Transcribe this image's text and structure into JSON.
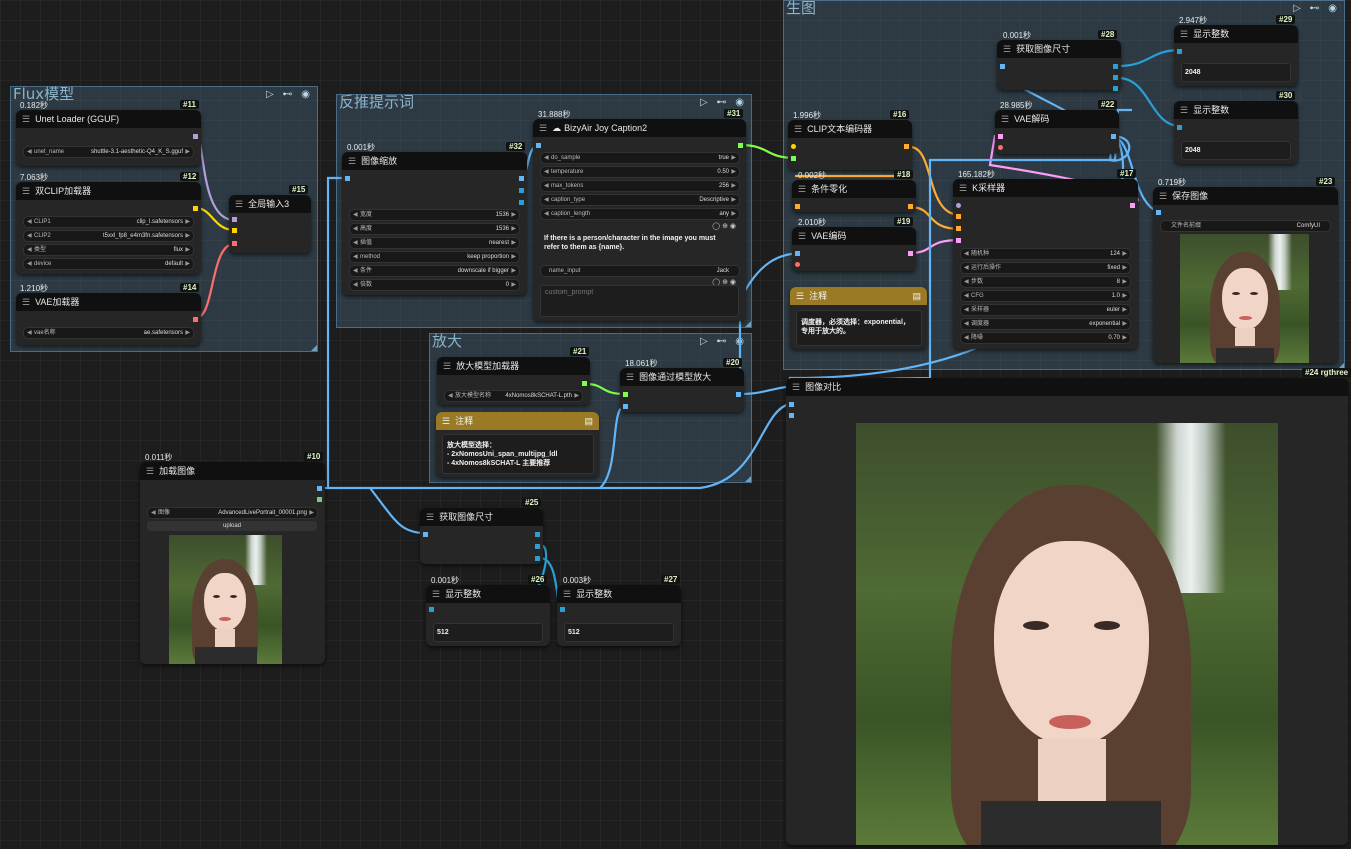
{
  "groups": {
    "flux": {
      "title": "Flux模型"
    },
    "prompt": {
      "title": "反推提示词"
    },
    "upscale": {
      "title": "放大"
    },
    "gen": {
      "title": "生图"
    }
  },
  "group_icons": "▷ ⊷ ◉",
  "nodes": {
    "n11": {
      "time": "0.182秒",
      "id": "#11",
      "title": "Unet Loader (GGUF)",
      "widgets": [
        {
          "label": "unet_name",
          "value": "shuttle-3.1-aesthetic-Q4_K_S.gguf"
        }
      ]
    },
    "n12": {
      "time": "7.063秒",
      "id": "#12",
      "title": "双CLIP加载器",
      "widgets": [
        {
          "label": "CLIP1",
          "value": "clip_l.safetensors"
        },
        {
          "label": "CLIP2",
          "value": "t5xxl_fp8_e4m3fn.safetensors"
        },
        {
          "label": "类型",
          "value": "flux"
        },
        {
          "label": "device",
          "value": "default"
        }
      ]
    },
    "n14": {
      "time": "1.210秒",
      "id": "#14",
      "title": "VAE加载器",
      "widgets": [
        {
          "label": "vae名称",
          "value": "ae.safetensors"
        }
      ]
    },
    "n15": {
      "id": "#15",
      "title": "全局输入3"
    },
    "n32": {
      "time": "0.001秒",
      "id": "#32",
      "title": "图像缩放",
      "widgets": [
        {
          "label": "宽度",
          "value": "1536"
        },
        {
          "label": "高度",
          "value": "1536"
        },
        {
          "label": "插值",
          "value": "nearest"
        },
        {
          "label": "method",
          "value": "keep proportion"
        },
        {
          "label": "条件",
          "value": "downscale if bigger"
        },
        {
          "label": "倍数",
          "value": "0"
        }
      ]
    },
    "n31": {
      "time": "31.888秒",
      "id": "#31",
      "title": "BizyAir Joy Caption2",
      "widgets": [
        {
          "label": "do_sample",
          "value": "true"
        },
        {
          "label": "temperature",
          "value": "0.50"
        },
        {
          "label": "max_tokens",
          "value": "256"
        },
        {
          "label": "caption_type",
          "value": "Descriptive"
        },
        {
          "label": "caption_length",
          "value": "any"
        }
      ],
      "text": "If there is a person/character in the image you must\nrefer to them as {name}.",
      "name_input": {
        "label": "name_input",
        "value": "Jack"
      },
      "custom_prompt_placeholder": "custom_prompt",
      "icons": "◯ ⊕ ◉"
    },
    "n21": {
      "id": "#21",
      "title": "放大模型加载器",
      "widgets": [
        {
          "label": "放大模型名称",
          "value": "4xNomos8kSCHAT-L.pth"
        }
      ]
    },
    "n20": {
      "time": "18.061秒",
      "id": "#20",
      "title": "图像通过模型放大"
    },
    "note_upscale": {
      "title": "注释",
      "text": "放大模型选择：\n- 2xNomosUni_span_multijpg_ldl\n- 4xNomos8kSCHAT-L    主要推荐"
    },
    "n10": {
      "time": "0.011秒",
      "id": "#10",
      "title": "加载图像",
      "widgets": [
        {
          "label": "图像",
          "value": "AdvancedLivePortrait_00001.png"
        }
      ],
      "upload": "upload"
    },
    "n25": {
      "id": "#25",
      "title": "获取图像尺寸"
    },
    "n26": {
      "time": "0.001秒",
      "id": "#26",
      "title": "显示整数",
      "value": "512"
    },
    "n27": {
      "time": "0.003秒",
      "id": "#27",
      "title": "显示整数",
      "value": "512"
    },
    "n16": {
      "time": "1.996秒",
      "id": "#16",
      "title": "CLIP文本编码器"
    },
    "n18": {
      "time": "0.002秒",
      "id": "#18",
      "title": "条件零化"
    },
    "n19": {
      "time": "2.010秒",
      "id": "#19",
      "title": "VAE编码"
    },
    "note_gen": {
      "title": "注释",
      "text": "调度器，必须选择：exponential，\n专用于放大的。"
    },
    "n28": {
      "time": "0.001秒",
      "id": "#28",
      "title": "获取图像尺寸"
    },
    "n22": {
      "time": "28.985秒",
      "id": "#22",
      "title": "VAE解码"
    },
    "n29": {
      "time": "2.947秒",
      "id": "#29",
      "title": "显示整数",
      "value": "2048"
    },
    "n30": {
      "id": "#30",
      "title": "显示整数",
      "value": "2048"
    },
    "n17": {
      "time": "165.182秒",
      "id": "#17",
      "title": "K采样器",
      "widgets": [
        {
          "label": "随机种",
          "value": "124"
        },
        {
          "label": "运行后操作",
          "value": "fixed"
        },
        {
          "label": "步数",
          "value": "8"
        },
        {
          "label": "CFG",
          "value": "1.0"
        },
        {
          "label": "采样器",
          "value": "euler"
        },
        {
          "label": "调度器",
          "value": "exponential"
        },
        {
          "label": "降噪",
          "value": "0.70"
        }
      ]
    },
    "n23": {
      "time": "0.719秒",
      "id": "#23",
      "title": "保存图像",
      "widgets": [
        {
          "label": "文件名前缀",
          "value": "ComfyUI"
        }
      ]
    },
    "n24": {
      "id": "#24 rgthree",
      "title": "图像对比"
    }
  },
  "colors": {
    "image_link": "#64b5f6",
    "model_link": "#b39ddb",
    "clip_link": "#ffd500",
    "vae_link": "#ff6e6e",
    "latent_link": "#ff9cf9",
    "conditioning_link": "#ffa931",
    "upscale_model_link": "#7cff4a",
    "int_link": "#2a9fd6",
    "note_header": "#9a7a25"
  }
}
